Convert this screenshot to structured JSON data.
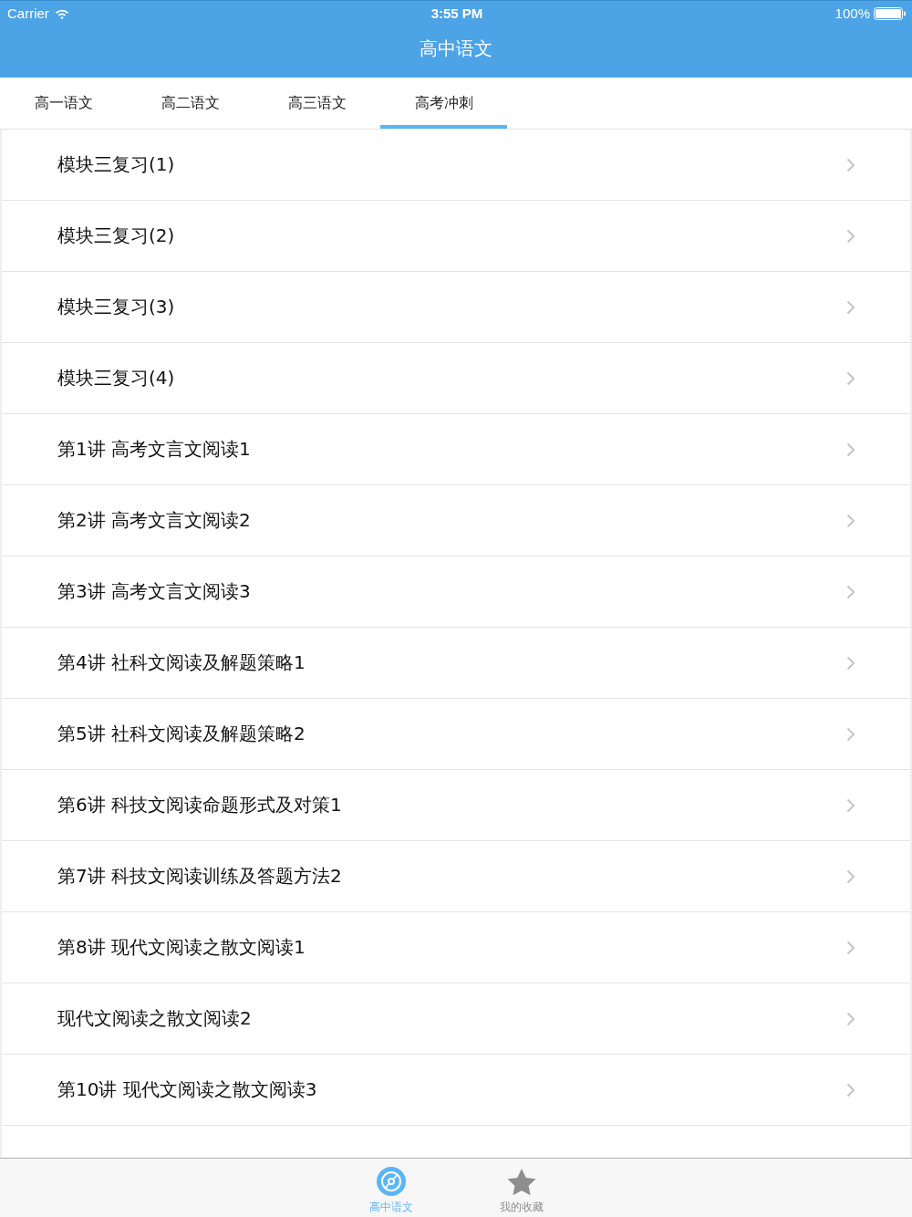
{
  "status_bar": {
    "carrier": "Carrier",
    "time": "3:55 PM",
    "battery": "100%"
  },
  "nav_bar": {
    "title": "高中语文"
  },
  "tabs": [
    {
      "label": "高一语文",
      "selected": false
    },
    {
      "label": "高二语文",
      "selected": false
    },
    {
      "label": "高三语文",
      "selected": false
    },
    {
      "label": "高考冲刺",
      "selected": true
    }
  ],
  "list": {
    "items": [
      "模块三复习(1)",
      "模块三复习(2)",
      "模块三复习(3)",
      "模块三复习(4)",
      "第1讲 高考文言文阅读1",
      "第2讲 高考文言文阅读2",
      "第3讲 高考文言文阅读3",
      "第4讲 社科文阅读及解题策略1",
      "第5讲 社科文阅读及解题策略2",
      "第6讲 科技文阅读命题形式及对策1",
      "第7讲 科技文阅读训练及答题方法2",
      "第8讲 现代文阅读之散文阅读1",
      "现代文阅读之散文阅读2",
      "第10讲 现代文阅读之散文阅读3"
    ]
  },
  "tab_bar": [
    {
      "label": "高中语文",
      "kind": "disc",
      "selected": true
    },
    {
      "label": "我的收藏",
      "kind": "star",
      "selected": false
    }
  ]
}
